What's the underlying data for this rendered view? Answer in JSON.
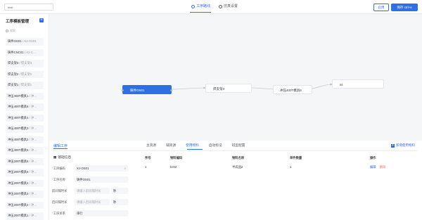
{
  "topbar": {
    "search_value": "testi",
    "tabs": [
      {
        "label": "工序路线"
      },
      {
        "label": "仿真设置"
      }
    ],
    "enable_label": "启用",
    "save_label": "保存 ctrl+s"
  },
  "sidebar": {
    "title": "工序模板管理",
    "search_placeholder": "搜索",
    "items": [
      {
        "name": "铸件OS01",
        "sub": " / XJ-OS01"
      },
      {
        "name": "铸件CNC01",
        "sub": " / XJ-C…"
      },
      {
        "name": "焊支架3",
        "sub": " / 焊支架3"
      },
      {
        "name": "焊支架2",
        "sub": " / 焊支架2"
      },
      {
        "name": "焊支架1",
        "sub": " / 焊支架1"
      },
      {
        "name": "冲压400T模具1",
        "sub": " / 冲…"
      },
      {
        "name": "冲压400T模具6",
        "sub": " / 冲…"
      },
      {
        "name": "冲压400T模具4",
        "sub": " / 冲…"
      },
      {
        "name": "冲压400T模具3",
        "sub": " / 冲…"
      },
      {
        "name": "冲压400T模具2",
        "sub": " / 冲…"
      },
      {
        "name": "冲压400T模具5",
        "sub": " / 冲…"
      },
      {
        "name": "冲压200T模具6",
        "sub": " / 冲…"
      },
      {
        "name": "冲压200T模具5",
        "sub": " / 冲…"
      },
      {
        "name": "冲压200T模具4",
        "sub": " / 冲…"
      },
      {
        "name": "冲压200T模具3",
        "sub": " / 冲…"
      },
      {
        "name": "冲压200T模具2",
        "sub": " / 冲…"
      },
      {
        "name": "冲压200T模具1",
        "sub": " / 冲…"
      }
    ]
  },
  "canvas": {
    "nodes": [
      {
        "label": "铸件OS01"
      },
      {
        "label": "焊支架3"
      },
      {
        "label": "冲压400T模具6"
      },
      {
        "label": "xs"
      }
    ]
  },
  "panel": {
    "title": "编辑工序",
    "tabs": [
      {
        "label": "主资源"
      },
      {
        "label": "辅资源"
      },
      {
        "label": "使用物料"
      },
      {
        "label": "自动标记"
      },
      {
        "label": "班型配置"
      }
    ],
    "add_material_label": "新增使用物料",
    "basic_info_label": "基础信息",
    "fields": {
      "code_label": "工序编码",
      "code_value": "XJ-OS01",
      "name_label": "工序名称",
      "name_value": "铸件OS01",
      "prep_label": "前间隔时长",
      "prep_placeholder": "请输入前间隔时长",
      "prep_unit": "秒",
      "post_label": "后间隔时长",
      "post_placeholder": "请输入后间隔时长",
      "post_unit": "秒",
      "relation_label": "工序关系",
      "relation_value": "串行"
    },
    "table": {
      "headers": [
        "序号",
        "物料编码",
        "物料名称",
        "单件数量",
        "操作"
      ],
      "rows": [
        {
          "idx": "1",
          "code": "bz02",
          "name": "半成品2",
          "qty": "1",
          "edit": "编辑",
          "delete": "删除"
        }
      ]
    }
  }
}
